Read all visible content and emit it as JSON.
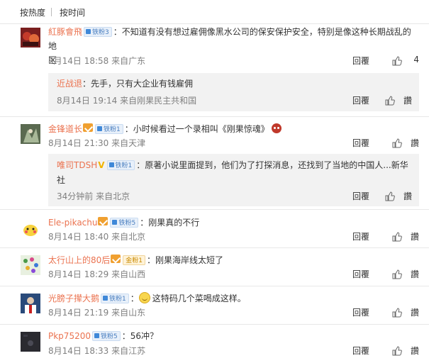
{
  "sort": {
    "hot": "按热度",
    "time": "按时间"
  },
  "actions": {
    "reply": "回覆",
    "like": "讚"
  },
  "comments": [
    {
      "user": "紅豚會飛",
      "badge": "铁粉3",
      "text": "：不知道有没有想过雇佣像黑水公司的保安保护安全，特别是像这种长期战乱的地区",
      "text_line1": "：不知道有没有想过雇佣像黑水公司的保安保护安全，特别是像这种长期战乱的地",
      "text_line2": "区",
      "meta": "8月14日 18:58 来自广东",
      "likes": "4",
      "sub": {
        "user": "近战退",
        "text": "：先手，只有大企业有钱雇佣",
        "meta": "8月14日 19:14 来自刚果民主共和国"
      }
    },
    {
      "user": "金锋道长",
      "badge": "铁粉1",
      "text": "：小时候看过一个录相叫《刚果惊魂》",
      "meta": "8月14日 21:30 来自天津",
      "sub": {
        "user": "唯司TDSH",
        "badge": "铁粉1",
        "text_line1": "：原著小说里面提到，他们为了打探消息，还找到了当地的中国人...新华",
        "text_line2": "社",
        "meta": "34分钟前 来自北京"
      }
    },
    {
      "user": "Ele-pikachu",
      "badge": "铁粉5",
      "text": "：刚果真的不行",
      "meta": "8月14日 18:40 来自北京"
    },
    {
      "user": "太行山上的80后",
      "badge": "金粉1",
      "text": "：刚果海岸线太短了",
      "meta": "8月14日 18:29 来自山西"
    },
    {
      "user": "光膀子撵大鹅",
      "badge": "铁粉1",
      "text": "这特码几个菜喝成这样。",
      "meta": "8月14日 21:19 来自山东"
    },
    {
      "user": "Pkp75200",
      "badge": "铁粉5",
      "text": "：56冲？",
      "meta": "8月14日 18:33 来自江苏"
    }
  ],
  "colors": {
    "username": "#eb7350",
    "meta": "#808080",
    "badge_bg": "#e8f0fa",
    "subbox_bg": "#f2f2f2"
  }
}
